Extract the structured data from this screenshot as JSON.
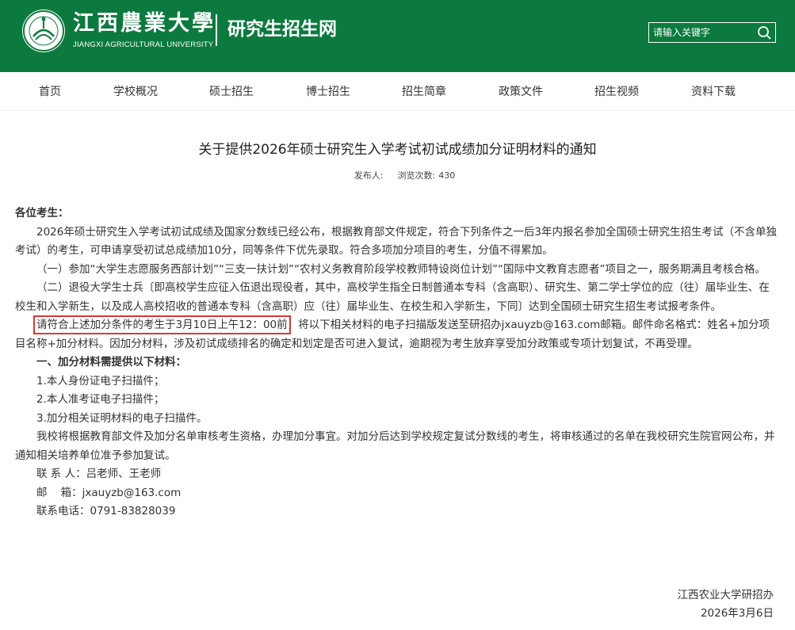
{
  "header": {
    "university_cn": "江西農業大學",
    "university_en": "JIANGXI AGRICULTURAL UNIVERSITY",
    "site_name": "研究生招生网",
    "search_placeholder": "请输入关键字",
    "bg_color": "#0c7a3e"
  },
  "nav": {
    "items": [
      {
        "label": "首页"
      },
      {
        "label": "学校概况"
      },
      {
        "label": "硕士招生"
      },
      {
        "label": "博士招生"
      },
      {
        "label": "招生简章"
      },
      {
        "label": "政策文件"
      },
      {
        "label": "招生视频"
      },
      {
        "label": "资料下载"
      }
    ]
  },
  "article": {
    "title": "关于提供2026年硕士研究生入学考试初试成绩加分证明材料的通知",
    "publisher_label": "发布人:",
    "views_label": "浏览次数:",
    "views": "430",
    "greeting": "各位考生：",
    "p1": "2026年硕士研究生入学考试初试成绩及国家分数线已经公布，根据教育部文件规定，符合下列条件之一后3年内报名参加全国硕士研究生招生考试（不含单独考试）的考生，可申请享受初试总成绩加10分，同等条件下优先录取。符合多项加分项目的考生，分值不得累加。",
    "p2": "（一）参加“大学生志愿服务西部计划”“三支一扶计划”“农村义务教育阶段学校教师特设岗位计划”“国际中文教育志愿者”项目之一，服务期满且考核合格。",
    "p3": "（二）退役大学生士兵〔即高校学生应征入伍退出现役者，其中，高校学生指全日制普通本专科（含高职）、研究生、第二学士学位的应（往）届毕业生、在校生和入学新生，以及成人高校招收的普通本专科（含高职）应（往）届毕业生、在校生和入学新生，下同〕达到全国硕士研究生招生考试报考条件。",
    "p4_highlight": "请符合上述加分条件的考生于3月10日上午12：00前",
    "p4_rest": "，将以下相关材料的电子扫描版发送至研招办jxauyzb@163.com邮箱。邮件命名格式：姓名+加分项目名称+加分材料。因加分材料，涉及初试成绩排名的确定和划定是否可进入复试，逾期视为考生放弃享受加分政策或专项计划复试，不再受理。",
    "section_heading": "一、加分材料需提供以下材料：",
    "items": [
      "1.本人身份证电子扫描件；",
      "2.本人准考证电子扫描件；",
      "3.加分相关证明材料的电子扫描件。"
    ],
    "p5": "我校将根据教育部文件及加分名单审核考生资格，办理加分事宜。对加分后达到学校规定复试分数线的考生，将审核通过的名单在我校研究生院官网公布，并通知相关培养单位准予参加复试。",
    "contact_person": "联 系 人：吕老师、王老师",
    "contact_email": "邮    箱：jxauyzb@163.com",
    "contact_phone": "联系电话：0791-83828039",
    "signoff_org": "江西农业大学研招办",
    "signoff_date": "2026年3月6日"
  }
}
